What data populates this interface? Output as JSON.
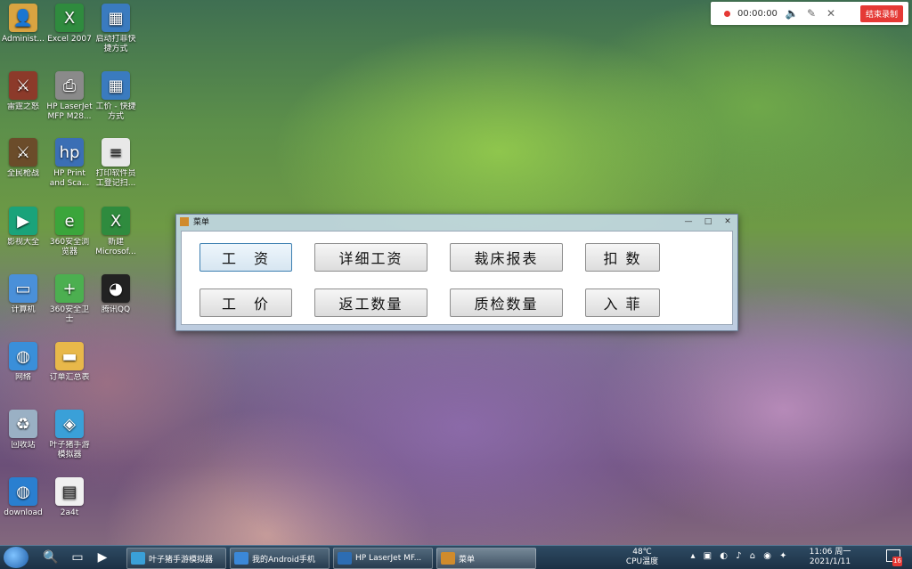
{
  "desktop": {
    "icons": [
      {
        "label": "Administ...",
        "icon": "user-folder-icon",
        "color": "#d9a441"
      },
      {
        "label": "Excel 2007",
        "icon": "excel-icon",
        "color": "#2f8b3e"
      },
      {
        "label": "启动打菲快捷方式",
        "icon": "shortcut-app-icon",
        "color": "#3a7bbf"
      },
      {
        "label": "雷霆之怒",
        "icon": "game-icon",
        "color": "#8c3a2a"
      },
      {
        "label": "HP LaserJet MFP M28...",
        "icon": "printer-icon",
        "color": "#8a8a8a"
      },
      {
        "label": "工价 - 快捷方式",
        "icon": "shortcut-app-icon",
        "color": "#3a7bbf"
      },
      {
        "label": "全民枪战",
        "icon": "game-icon",
        "color": "#6b4c2a"
      },
      {
        "label": "HP Print and Sca...",
        "icon": "hp-scan-icon",
        "color": "#3b6fb5"
      },
      {
        "label": "打印软件员工登记扫...",
        "icon": "document-icon",
        "color": "#e8e8e8"
      },
      {
        "label": "影视大全",
        "icon": "video-icon",
        "color": "#1aa37a"
      },
      {
        "label": "360安全浏览器",
        "icon": "browser-icon",
        "color": "#3ba53b"
      },
      {
        "label": "新建 Microsof...",
        "icon": "excel-doc-icon",
        "color": "#2f8b3e"
      },
      {
        "label": "计算机",
        "icon": "computer-icon",
        "color": "#4a90d9"
      },
      {
        "label": "360安全卫士",
        "icon": "security-icon",
        "color": "#4caf50"
      },
      {
        "label": "腾讯QQ",
        "icon": "qq-icon",
        "color": "#222222"
      },
      {
        "label": "网络",
        "icon": "network-icon",
        "color": "#3a8fd9"
      },
      {
        "label": "订单汇总表",
        "icon": "folder-icon",
        "color": "#e8b84a"
      },
      {
        "label": "回收站",
        "icon": "recycle-bin-icon",
        "color": "#9ab0c4"
      },
      {
        "label": "叶子猪手游模拟器",
        "icon": "emulator-icon",
        "color": "#3aa0d8"
      },
      {
        "label": "download",
        "icon": "globe-icon",
        "color": "#2a7fd0"
      },
      {
        "label": "2a4t",
        "icon": "file-icon",
        "color": "#f0f0f0"
      }
    ]
  },
  "recorder": {
    "time": "00:00:00",
    "stop_label": "结束录制",
    "accent": "#e53935"
  },
  "menu_window": {
    "title": "菜单",
    "buttons_row1": [
      "工　资",
      "详细工资",
      "裁床报表",
      "扣 数"
    ],
    "buttons_row2": [
      "工　价",
      "返工数量",
      "质检数量",
      "入 菲"
    ]
  },
  "taskbar": {
    "tasks": [
      {
        "label": "叶子猪手游模拟器",
        "icon": "emulator-icon",
        "color": "#3aa0d8"
      },
      {
        "label": "我的Android手机",
        "icon": "phone-icon",
        "color": "#3b88d8"
      },
      {
        "label": "HP LaserJet MF...",
        "icon": "hp-icon",
        "color": "#2d6db3"
      },
      {
        "label": "菜单",
        "icon": "app-window-icon",
        "color": "#d08b2c"
      }
    ],
    "temperature": "48℃",
    "temp_label": "CPU温度",
    "time": "11:06 周一",
    "date": "2021/1/11",
    "notification_count": "16"
  }
}
